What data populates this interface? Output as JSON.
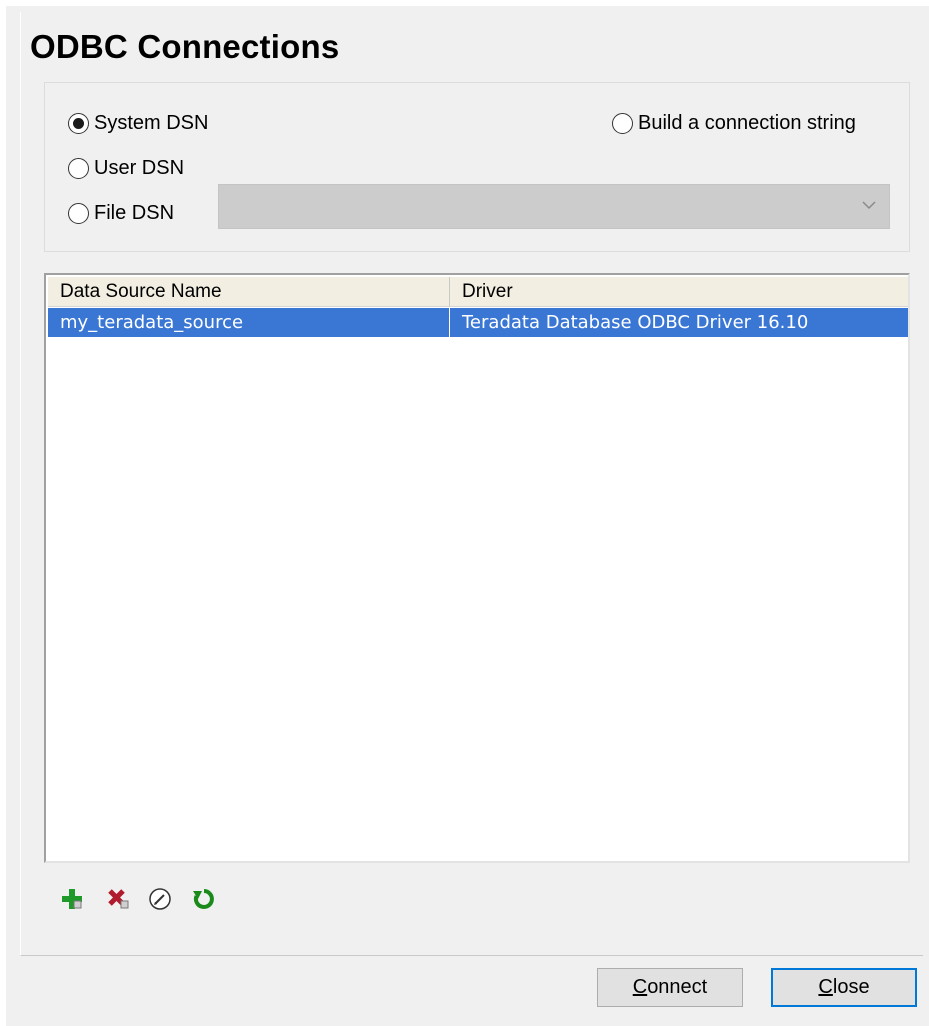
{
  "dialog": {
    "title": "ODBC Connections"
  },
  "options": {
    "system_dsn": {
      "label": "System DSN",
      "selected": true
    },
    "user_dsn": {
      "label": "User DSN",
      "selected": false
    },
    "file_dsn": {
      "label": "File DSN",
      "selected": false
    },
    "build_connection_string": {
      "label": "Build a connection string",
      "selected": false
    },
    "file_dsn_select_value": ""
  },
  "table": {
    "columns": [
      "Data Source Name",
      "Driver"
    ],
    "rows": [
      {
        "name": "my_teradata_source",
        "driver": "Teradata Database ODBC Driver 16.10",
        "selected": true
      }
    ]
  },
  "toolbar": {
    "icons": [
      "add-icon",
      "delete-icon",
      "edit-icon",
      "refresh-icon"
    ]
  },
  "buttons": {
    "connect_label": "Connect",
    "close_label": "Close"
  },
  "colors": {
    "selection": "#3a77d4",
    "header_bg": "#f2eee2",
    "default_button_border": "#0078d7",
    "add_green": "#1f9a2a",
    "delete_red": "#b01c2e",
    "refresh_green": "#1a8a1a"
  }
}
